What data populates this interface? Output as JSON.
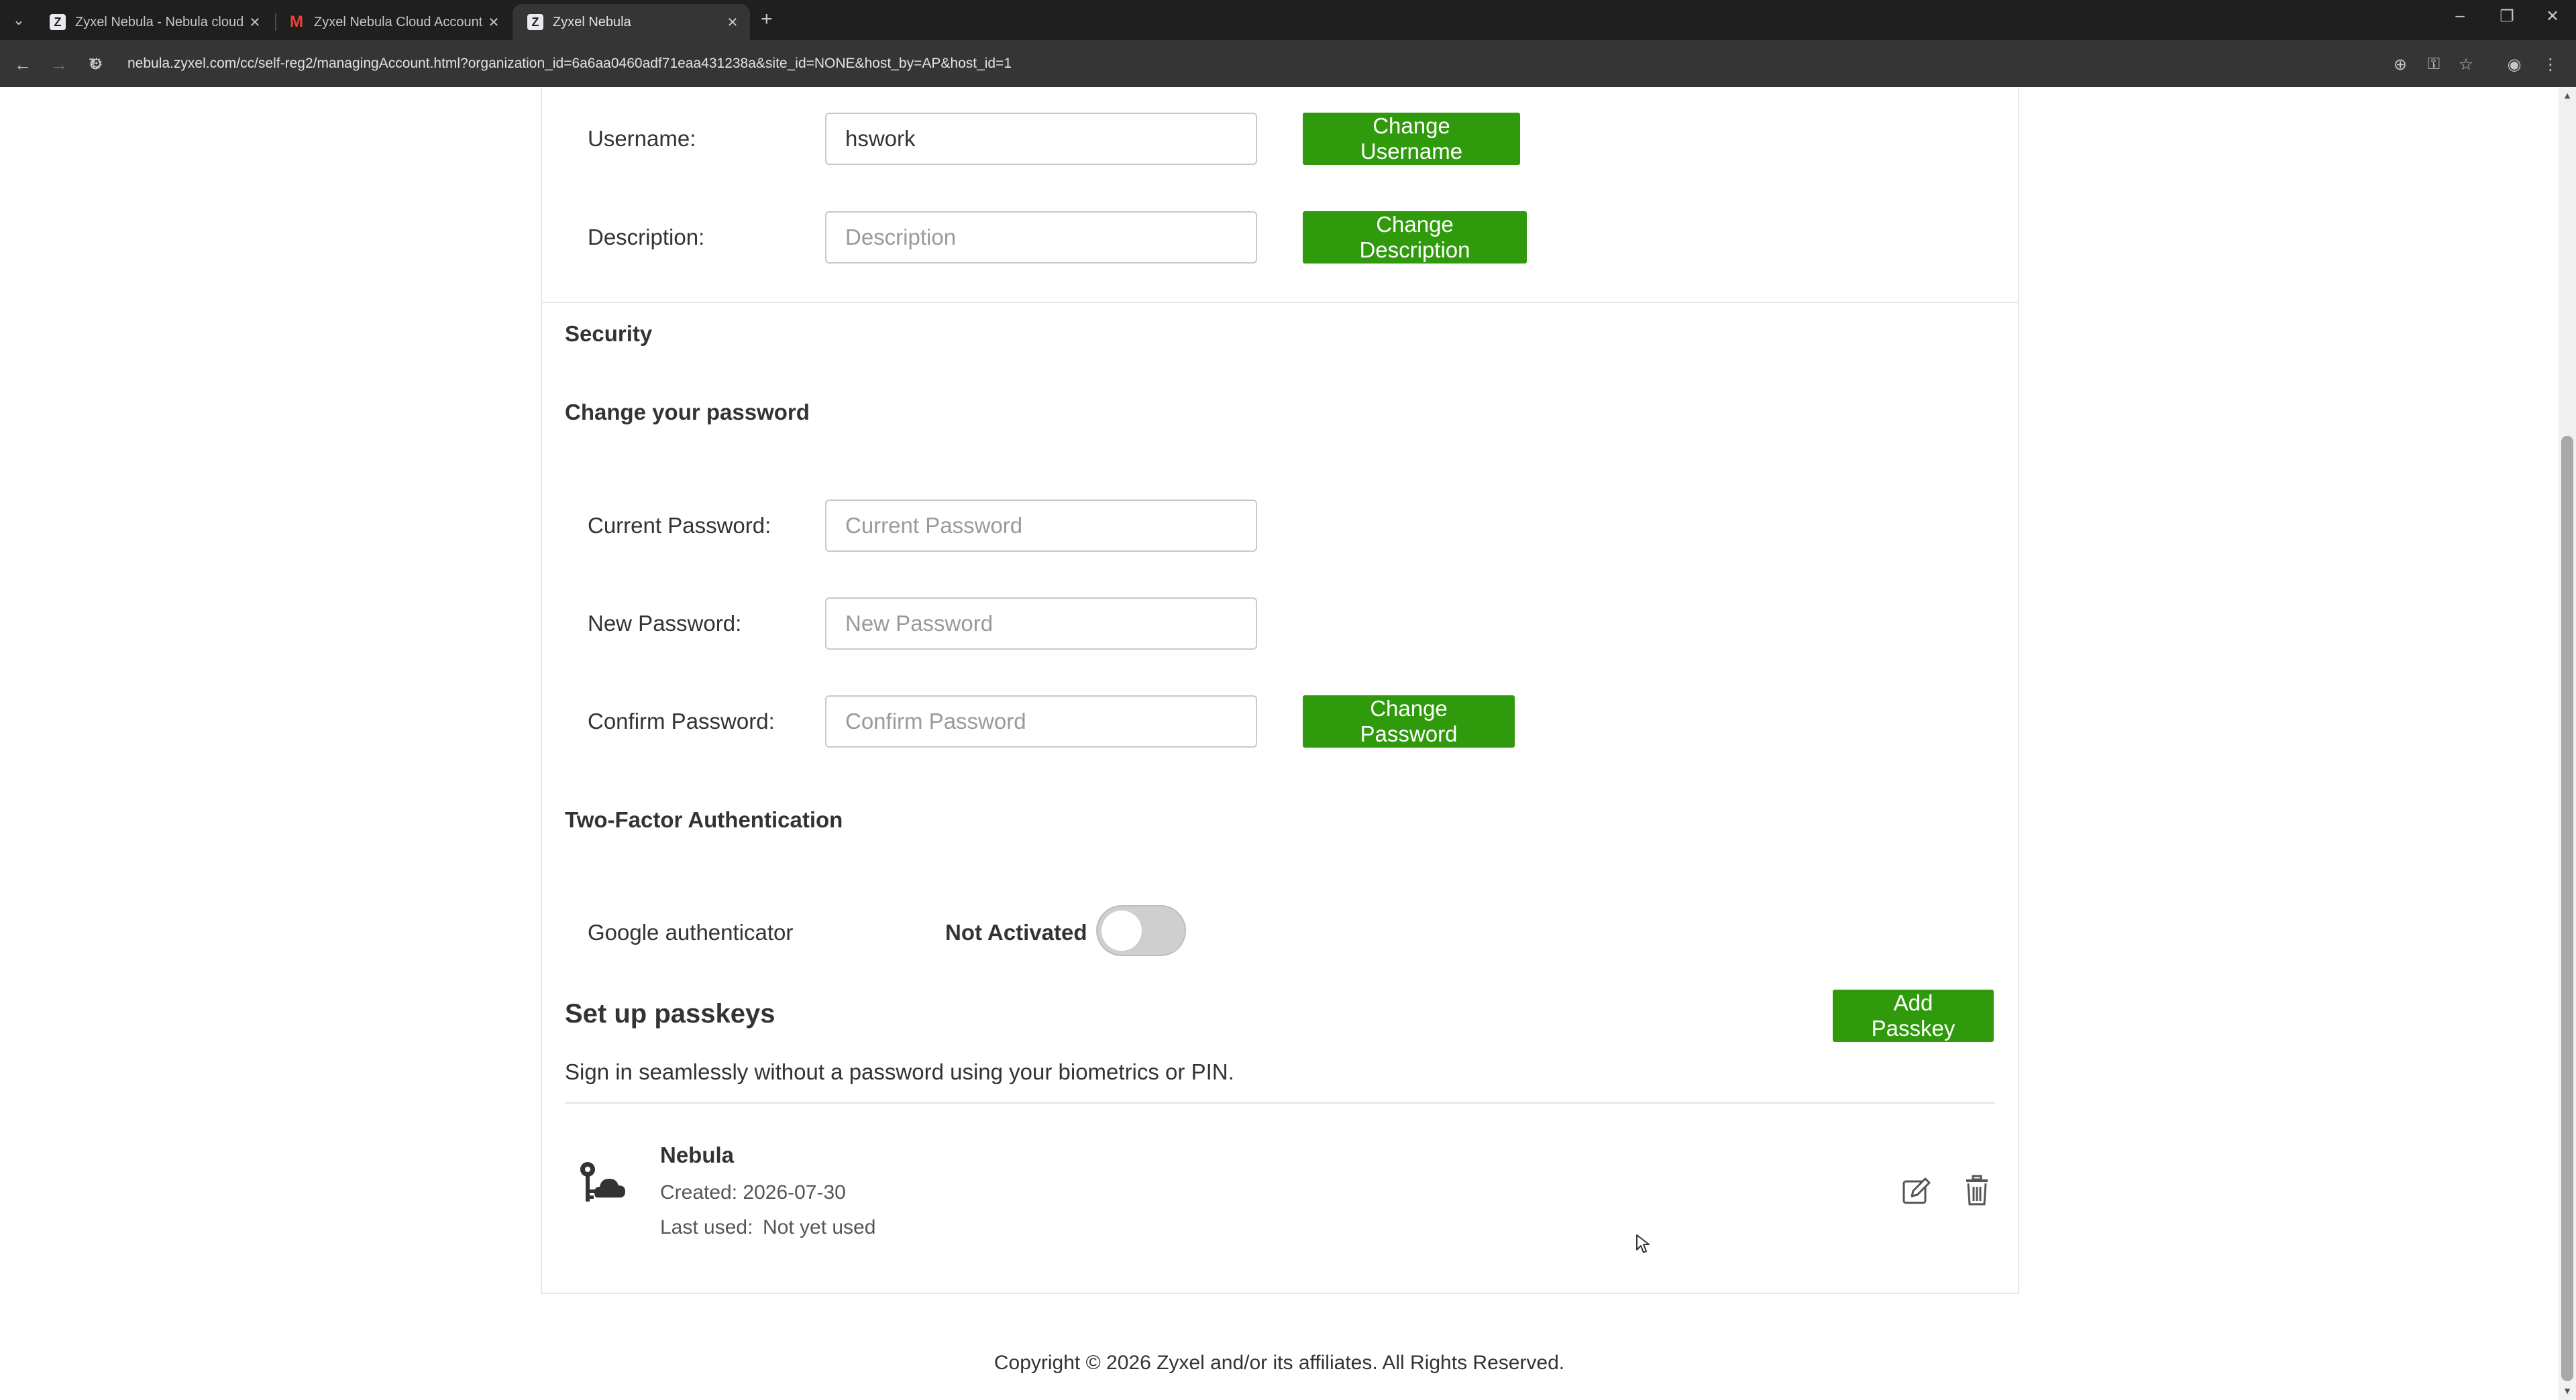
{
  "browser": {
    "tabs": [
      {
        "title": "Zyxel Nebula - Nebula cloud ar",
        "favicon": "Z"
      },
      {
        "title": "Zyxel Nebula Cloud Account In",
        "favicon": "M"
      },
      {
        "title": "Zyxel Nebula",
        "favicon": "Z"
      }
    ],
    "active_tab": 2,
    "url": "nebula.zyxel.com/cc/self-reg2/managingAccount.html?organization_id=6a6aa0460adf71eaa431238a&site_id=NONE&host_by=AP&host_id=1"
  },
  "account": {
    "username_label": "Username:",
    "username_value": "hswork",
    "change_username": "Change Username",
    "description_label": "Description:",
    "description_placeholder": "Description",
    "change_description": "Change Description"
  },
  "security": {
    "title": "Security",
    "password_heading": "Change your password",
    "current_label": "Current Password:",
    "current_placeholder": "Current Password",
    "new_label": "New Password:",
    "new_placeholder": "New Password",
    "confirm_label": "Confirm Password:",
    "confirm_placeholder": "Confirm Password",
    "change_password": "Change Password"
  },
  "two_factor": {
    "heading": "Two-Factor Authentication",
    "method": "Google authenticator",
    "status": "Not Activated",
    "enabled": false
  },
  "passkeys": {
    "heading": "Set up passkeys",
    "add_button": "Add Passkey",
    "description": "Sign in seamlessly without a password using your biometrics or PIN.",
    "items": [
      {
        "name": "Nebula",
        "created": "Created: 2026-07-30",
        "last_used_label": "Last used:",
        "last_used_value": "Not yet used"
      }
    ]
  },
  "footer": {
    "copyright": "Copyright © 2026 Zyxel and/or its affiliates. All Rights Reserved."
  }
}
